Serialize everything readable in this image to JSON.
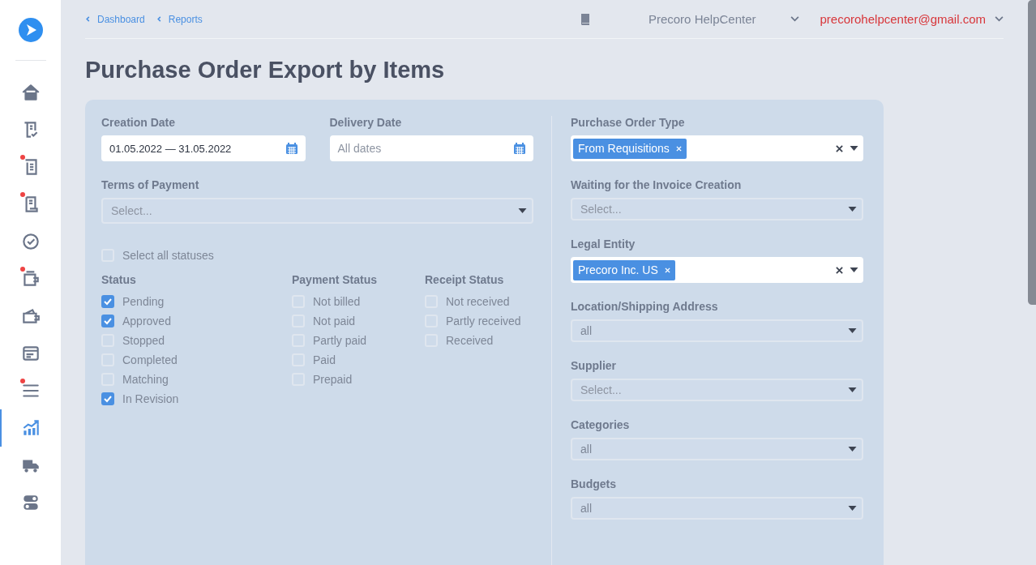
{
  "sidebar": {
    "items": [
      {
        "selected": false,
        "badge": false
      },
      {
        "selected": false,
        "badge": false
      },
      {
        "selected": false,
        "badge": true
      },
      {
        "selected": false,
        "badge": true
      },
      {
        "selected": false,
        "badge": false
      },
      {
        "selected": false,
        "badge": true
      },
      {
        "selected": false,
        "badge": false
      },
      {
        "selected": false,
        "badge": false
      },
      {
        "selected": false,
        "badge": true
      },
      {
        "selected": true,
        "badge": false
      },
      {
        "selected": false,
        "badge": false
      },
      {
        "selected": false,
        "badge": false
      }
    ]
  },
  "breadcrumbs": [
    {
      "label": "Dashboard"
    },
    {
      "label": "Reports"
    }
  ],
  "header": {
    "help_center": "Precoro HelpCenter",
    "account": "precorohelpcenter@gmail.com"
  },
  "title": "Purchase Order Export by Items",
  "filters_left": [
    {
      "kind": "date",
      "label": "Creation Date",
      "value": "01.05.2022 — 31.05.2022"
    },
    {
      "kind": "date",
      "label": "Delivery Date",
      "placeholder": "All dates"
    },
    {
      "kind": "select",
      "label": "Terms of Payment",
      "placeholder": "Select..."
    }
  ],
  "select_all": {
    "label": "Select all statuses",
    "checked": false
  },
  "status_groups": [
    {
      "title": "Status",
      "options": [
        {
          "label": "Pending",
          "checked": true
        },
        {
          "label": "Approved",
          "checked": true
        },
        {
          "label": "Stopped",
          "checked": false
        },
        {
          "label": "Completed",
          "checked": false
        },
        {
          "label": "Matching",
          "checked": false
        },
        {
          "label": "In Revision",
          "checked": true
        }
      ]
    },
    {
      "title": "Payment Status",
      "options": [
        {
          "label": "Not billed",
          "checked": false
        },
        {
          "label": "Not paid",
          "checked": false
        },
        {
          "label": "Partly paid",
          "checked": false
        },
        {
          "label": "Paid",
          "checked": false
        },
        {
          "label": "Prepaid",
          "checked": false
        }
      ]
    },
    {
      "title": "Receipt Status",
      "options": [
        {
          "label": "Not received",
          "checked": false
        },
        {
          "label": "Partly received",
          "checked": false
        },
        {
          "label": "Received",
          "checked": false
        }
      ]
    }
  ],
  "filters_right": [
    {
      "kind": "tags",
      "label": "Purchase Order Type",
      "tags": [
        "From Requisitions"
      ]
    },
    {
      "kind": "select",
      "label": "Waiting for the Invoice Creation",
      "placeholder": "Select..."
    },
    {
      "kind": "tags",
      "label": "Legal Entity",
      "tags": [
        "Precoro Inc. US"
      ]
    },
    {
      "kind": "select",
      "label": "Location/Shipping Address",
      "value": "all"
    },
    {
      "kind": "select",
      "label": "Supplier",
      "placeholder": "Select..."
    },
    {
      "kind": "select",
      "label": "Categories",
      "value": "all"
    },
    {
      "kind": "select",
      "label": "Budgets",
      "value": "all"
    }
  ]
}
